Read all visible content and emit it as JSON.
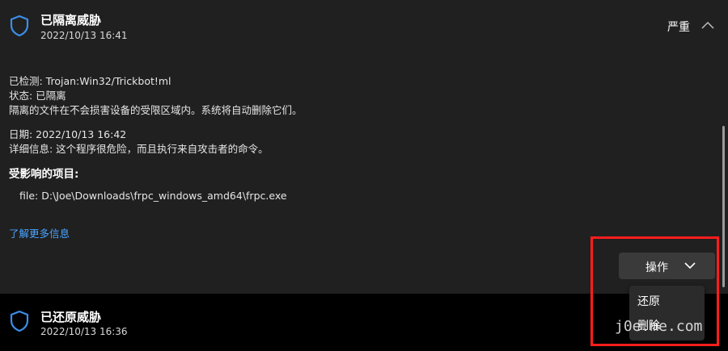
{
  "quarantined": {
    "title": "已隔离威胁",
    "timestamp": "2022/10/13 16:41",
    "severity": "严重",
    "detected": "已检测: Trojan:Win32/Trickbot!ml",
    "status": "状态: 已隔离",
    "note": "隔离的文件在不会损害设备的受限区域内。系统将自动删除它们。",
    "date": "日期: 2022/10/13 16:42",
    "details": "详细信息: 这个程序很危险，而且执行来自攻击者的命令。",
    "affected_heading": "受影响的项目:",
    "affected_file": "file: D:\\Joe\\Downloads\\frpc_windows_amd64\\frpc.exe",
    "learn_more": "了解更多信息",
    "action_label": "操作",
    "menu": [
      "还原",
      "删除"
    ]
  },
  "restored": {
    "title": "已还原威胁",
    "timestamp": "2022/10/13 16:36"
  },
  "watermark": "j0e.me.com",
  "colors": {
    "accent_link": "#4aa3ff",
    "highlight_box": "#ff1d1d",
    "shield_stroke": "#3b8ee8"
  },
  "icons": [
    "shield-icon",
    "chevron-up-icon",
    "chevron-down-icon"
  ]
}
